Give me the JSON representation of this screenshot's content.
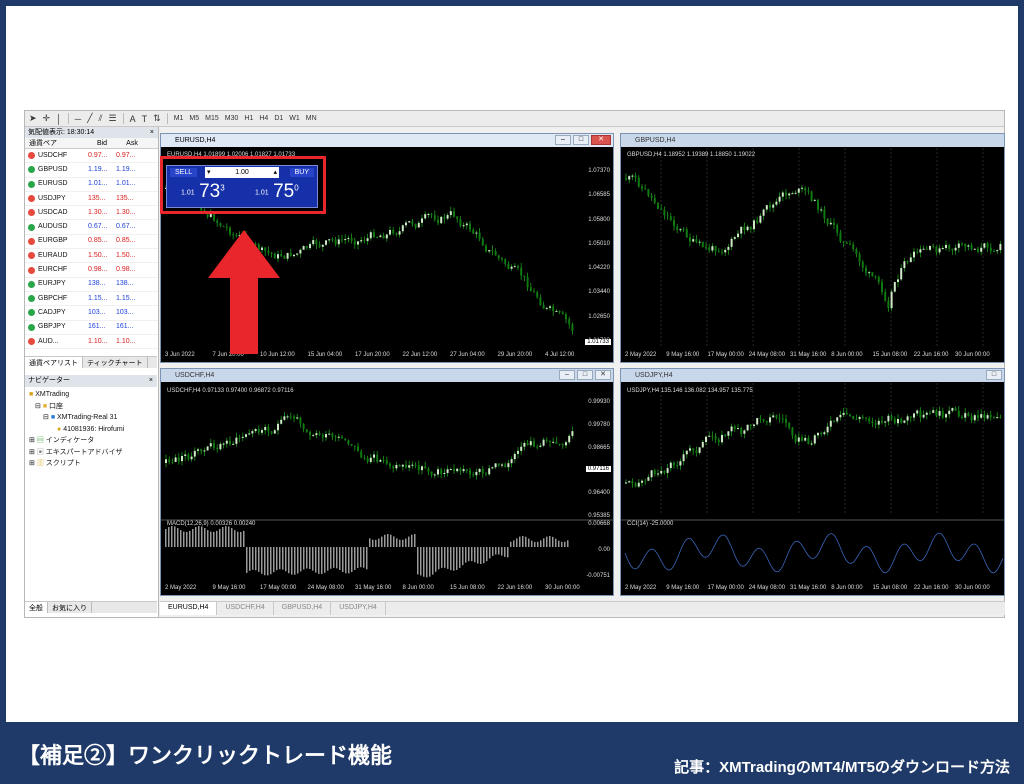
{
  "banner": {
    "title": "【補足②】ワンクリックトレード機能",
    "subtitle": "記事：XMTradingのMT4/MT5のダウンロード方法"
  },
  "toolbar": {
    "timeframes": [
      "M1",
      "M5",
      "M15",
      "M30",
      "H1",
      "H4",
      "D1",
      "W1",
      "MN"
    ]
  },
  "market_watch": {
    "title": "気配値表示: 18:30:14",
    "columns": [
      "通貨ペア",
      "Bid",
      "Ask"
    ],
    "rows": [
      {
        "symbol": "USDCHF",
        "bid": "0.97...",
        "ask": "0.97...",
        "dir": "down"
      },
      {
        "symbol": "GBPUSD",
        "bid": "1.19...",
        "ask": "1.19...",
        "dir": "up"
      },
      {
        "symbol": "EURUSD",
        "bid": "1.01...",
        "ask": "1.01...",
        "dir": "up"
      },
      {
        "symbol": "USDJPY",
        "bid": "135...",
        "ask": "135...",
        "dir": "down"
      },
      {
        "symbol": "USDCAD",
        "bid": "1.30...",
        "ask": "1.30...",
        "dir": "down"
      },
      {
        "symbol": "AUDUSD",
        "bid": "0.67...",
        "ask": "0.67...",
        "dir": "up"
      },
      {
        "symbol": "EURGBP",
        "bid": "0.85...",
        "ask": "0.85...",
        "dir": "down"
      },
      {
        "symbol": "EURAUD",
        "bid": "1.50...",
        "ask": "1.50...",
        "dir": "down"
      },
      {
        "symbol": "EURCHF",
        "bid": "0.98...",
        "ask": "0.98...",
        "dir": "down"
      },
      {
        "symbol": "EURJPY",
        "bid": "138...",
        "ask": "138...",
        "dir": "up"
      },
      {
        "symbol": "GBPCHF",
        "bid": "1.15...",
        "ask": "1.15...",
        "dir": "up"
      },
      {
        "symbol": "CADJPY",
        "bid": "103...",
        "ask": "103...",
        "dir": "up"
      },
      {
        "symbol": "GBPJPY",
        "bid": "161...",
        "ask": "161...",
        "dir": "up"
      },
      {
        "symbol": "AUD...",
        "bid": "1.10...",
        "ask": "1.10...",
        "dir": "down"
      }
    ],
    "tabs": [
      "通貨ペアリスト",
      "ティックチャート"
    ]
  },
  "navigator": {
    "title": "ナビゲーター",
    "items": [
      "XMTrading",
      "口座",
      "XMTrading-Real 31",
      "41081936: Hirofumi",
      "インディケータ",
      "エキスパートアドバイザ",
      "スクリプト"
    ],
    "tabs": [
      "全般",
      "お気に入り"
    ]
  },
  "charts": {
    "eurusd": {
      "title": "EURUSD,H4",
      "info": "EURUSD,H4  1.01899 1.02006 1.01827 1.01733",
      "scale": [
        "1.07370",
        "1.06585",
        "1.05800",
        "1.05010",
        "1.04220",
        "1.03440",
        "1.02650",
        "1.01733"
      ],
      "dates": [
        "3 Jun 2022",
        "7 Jun 20:00",
        "10 Jun 12:00",
        "15 Jun 04:00",
        "17 Jun 20:00",
        "22 Jun 12:00",
        "27 Jun 04:00",
        "29 Jun 20:00",
        "4 Jul 12:00"
      ],
      "current": "1.01733"
    },
    "gbpusd": {
      "title": "GBPUSD,H4",
      "info": "GBPUSD,H4  1.18952 1.19389 1.18850 1.19022",
      "dates": [
        "2 May 2022",
        "9 May 16:00",
        "17 May 00:00",
        "24 May 08:00",
        "31 May 16:00",
        "8 Jun 00:00",
        "15 Jun 08:00",
        "22 Jun 16:00",
        "30 Jun 00:00"
      ]
    },
    "usdchf": {
      "title": "USDCHF,H4",
      "info": "USDCHF,H4  0.97133 0.97400 0.96872 0.97116",
      "scale": [
        "0.99930",
        "0.99780",
        "0.98665",
        "0.97550",
        "0.96400",
        "0.95385"
      ],
      "current": "0.97116",
      "macd": "MACD(12,26,9) 0.00326 0.00240",
      "macd_scale": [
        "0.00668",
        "0.00",
        "-0.00751"
      ],
      "dates": [
        "2 May 2022",
        "9 May 16:00",
        "17 May 00:00",
        "24 May 08:00",
        "31 May 16:00",
        "8 Jun 00:00",
        "15 Jun 08:00",
        "22 Jun 16:00",
        "30 Jun 00:00"
      ]
    },
    "usdjpy": {
      "title": "USDJPY,H4",
      "info": "USDJPY,H4  135.146 136.082 134.957 135.775",
      "cci": "CCI(14) -25.0000",
      "dates": [
        "2 May 2022",
        "9 May 16:00",
        "17 May 00:00",
        "24 May 08:00",
        "31 May 16:00",
        "8 Jun 00:00",
        "15 Jun 08:00",
        "22 Jun 16:00",
        "30 Jun 00:00"
      ]
    }
  },
  "oneclick": {
    "sell_label": "SELL",
    "buy_label": "BUY",
    "lot": "1.00",
    "sell_small": "1.01",
    "sell_big": "73",
    "sell_sup": "3",
    "buy_small": "1.01",
    "buy_big": "75",
    "buy_sup": "0"
  },
  "taskbar": [
    "EURUSD,H4",
    "USDCHF,H4",
    "GBPUSD,H4",
    "USDJPY,H4"
  ],
  "colors": {
    "accent_red": "#e8262b",
    "banner": "#1f3a68",
    "candle": "#22a022"
  }
}
